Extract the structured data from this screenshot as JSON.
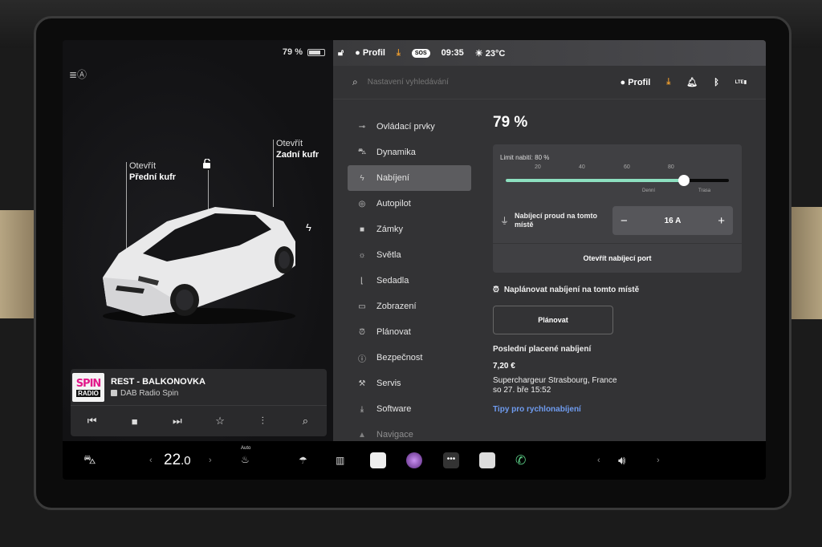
{
  "left": {
    "battery_pct": "79 %",
    "front_trunk": {
      "line1": "Otevřít",
      "line2": "Přední kufr"
    },
    "rear_trunk": {
      "line1": "Otevřít",
      "line2": "Zadní kufr"
    }
  },
  "media": {
    "station": "REST - BALKONOVKA",
    "source": "DAB Radio Spin",
    "logo_top": "SPIN",
    "logo_bottom": "RADIO"
  },
  "status": {
    "profile": "Profil",
    "sos": "SOS",
    "time": "09:35",
    "temp": "23°C"
  },
  "search": {
    "placeholder": "Nastavení vyhledávání"
  },
  "top": {
    "profile": "Profil",
    "network": "LTE"
  },
  "menu": [
    {
      "label": "Ovládací prvky",
      "icon": "toggle-icon"
    },
    {
      "label": "Dynamika",
      "icon": "car-icon"
    },
    {
      "label": "Nabíjení",
      "icon": "bolt-icon"
    },
    {
      "label": "Autopilot",
      "icon": "steering-icon"
    },
    {
      "label": "Zámky",
      "icon": "lock-icon"
    },
    {
      "label": "Světla",
      "icon": "sun-icon"
    },
    {
      "label": "Sedadla",
      "icon": "seat-icon"
    },
    {
      "label": "Zobrazení",
      "icon": "display-icon"
    },
    {
      "label": "Plánovat",
      "icon": "alarm-icon"
    },
    {
      "label": "Bezpečnost",
      "icon": "shield-icon"
    },
    {
      "label": "Servis",
      "icon": "wrench-icon"
    },
    {
      "label": "Software",
      "icon": "download-icon"
    },
    {
      "label": "Navigace",
      "icon": "nav-icon"
    }
  ],
  "charging": {
    "pct": "79 %",
    "limit_label": "Limit nabití: 80 %",
    "limit_value": 80,
    "ticks": [
      "20",
      "40",
      "60",
      "80"
    ],
    "zone_daily": "Denní",
    "zone_trip": "Trasa",
    "current_label": "Nabíjecí proud na tomto místě",
    "current_value": "16 A",
    "minus": "−",
    "plus": "+",
    "open_port": "Otevřít nabíjecí port",
    "schedule_label": "Naplánovat nabíjení na tomto místě",
    "plan_button": "Plánovat",
    "last_heading": "Poslední placené nabíjení",
    "last_price": "7,20 €",
    "last_location": "Superchargeur Strasbourg, France",
    "last_date": "so 27. bře 15:52",
    "tips": "Tipy pro rychlonabíjení"
  },
  "dock": {
    "temp_int": "22",
    "temp_dec": ".0",
    "seat_auto": "Auto",
    "left_chev": "‹",
    "right_chev": "›"
  }
}
